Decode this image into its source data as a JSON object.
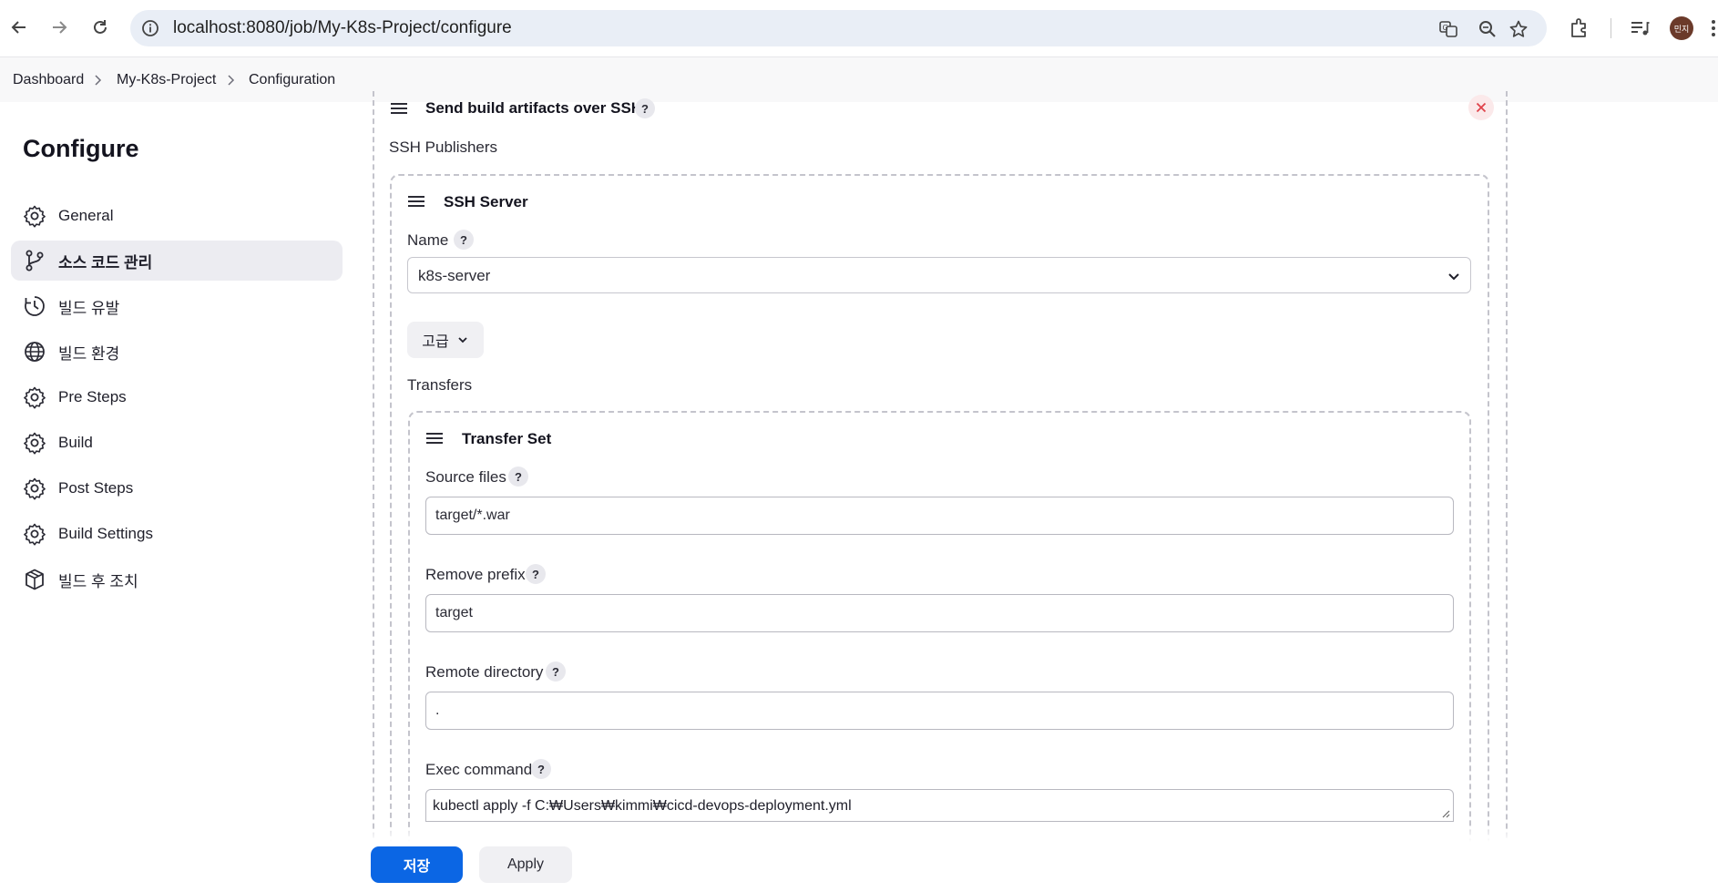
{
  "browser": {
    "url": "localhost:8080/job/My-K8s-Project/configure",
    "avatar_text": "민지"
  },
  "breadcrumb": {
    "items": [
      "Dashboard",
      "My-K8s-Project",
      "Configuration"
    ]
  },
  "sidebar": {
    "title": "Configure",
    "items": [
      {
        "label": "General",
        "icon": "gear-icon"
      },
      {
        "label": "소스 코드 관리",
        "icon": "git-branch-icon",
        "active": true
      },
      {
        "label": "빌드 유발",
        "icon": "clock-icon"
      },
      {
        "label": "빌드 환경",
        "icon": "globe-icon"
      },
      {
        "label": "Pre Steps",
        "icon": "gear-icon"
      },
      {
        "label": "Build",
        "icon": "gear-icon"
      },
      {
        "label": "Post Steps",
        "icon": "gear-icon"
      },
      {
        "label": "Build Settings",
        "icon": "gear-icon"
      },
      {
        "label": "빌드 후 조치",
        "icon": "package-icon"
      }
    ]
  },
  "publisher": {
    "title": "Send build artifacts over SSH",
    "help": "?",
    "ssh_publishers_label": "SSH Publishers",
    "server": {
      "title": "SSH Server",
      "name_label": "Name",
      "name_value": "k8s-server",
      "advanced_label": "고급",
      "transfers_label": "Transfers",
      "transfer_set": {
        "title": "Transfer Set",
        "source_files_label": "Source files",
        "source_files_value": "target/*.war",
        "remove_prefix_label": "Remove prefix",
        "remove_prefix_value": "target",
        "remote_directory_label": "Remote directory",
        "remote_directory_value": ".",
        "exec_command_label": "Exec command",
        "exec_command_value": "kubectl apply -f C:₩Users₩kimmi₩cicd-devops-deployment.yml"
      }
    }
  },
  "actions": {
    "save_label": "저장",
    "apply_label": "Apply"
  },
  "colors": {
    "primary_button": "#0b66e4",
    "close_button": "#e0424a"
  }
}
